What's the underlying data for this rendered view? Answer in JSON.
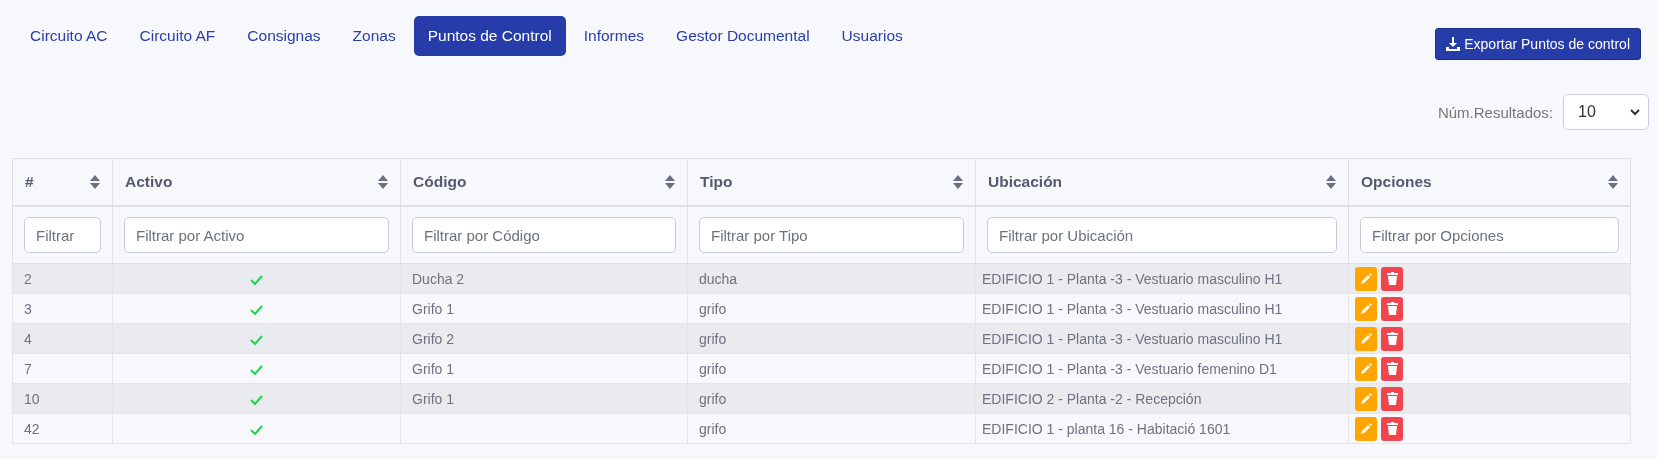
{
  "tabs": [
    {
      "label": "Circuito AC",
      "selected": false
    },
    {
      "label": "Circuito AF",
      "selected": false
    },
    {
      "label": "Consignas",
      "selected": false
    },
    {
      "label": "Zonas",
      "selected": false
    },
    {
      "label": "Puntos de Control",
      "selected": true
    },
    {
      "label": "Informes",
      "selected": false
    },
    {
      "label": "Gestor Documental",
      "selected": false
    },
    {
      "label": "Usuarios",
      "selected": false
    }
  ],
  "export_button": "Exportar Puntos de control",
  "results": {
    "label": "Núm.Resultados:",
    "value": "10"
  },
  "table": {
    "columns": [
      {
        "label": "#",
        "filter": {
          "placeholder": "Filtrar"
        }
      },
      {
        "label": "Activo",
        "filter": {
          "placeholder": "Filtrar por Activo"
        }
      },
      {
        "label": "Código",
        "filter": {
          "placeholder": "Filtrar por Código"
        }
      },
      {
        "label": "Tipo",
        "filter": {
          "placeholder": "Filtrar por Tipo"
        }
      },
      {
        "label": "Ubicación",
        "filter": {
          "placeholder": "Filtrar por Ubicación"
        }
      },
      {
        "label": "Opciones",
        "filter": {
          "placeholder": "Filtrar por Opciones"
        }
      }
    ],
    "rows": [
      {
        "id": "2",
        "active": true,
        "code": "Ducha 2",
        "type": "ducha",
        "location": "EDIFICIO 1 - Planta -3 - Vestuario masculino H1"
      },
      {
        "id": "3",
        "active": true,
        "code": "Grifo 1",
        "type": "grifo",
        "location": "EDIFICIO 1 - Planta -3 - Vestuario masculino H1"
      },
      {
        "id": "4",
        "active": true,
        "code": "Grifo 2",
        "type": "grifo",
        "location": "EDIFICIO 1 - Planta -3 - Vestuario masculino H1"
      },
      {
        "id": "7",
        "active": true,
        "code": "Grifo 1",
        "type": "grifo",
        "location": "EDIFICIO 1 - Planta -3 - Vestuario femenino D1"
      },
      {
        "id": "10",
        "active": true,
        "code": "Grifo 1",
        "type": "grifo",
        "location": "EDIFICIO 2 - Planta -2 - Recepción"
      },
      {
        "id": "42",
        "active": true,
        "type": "grifo",
        "location": "EDIFICIO 1 - planta 16 - Habitació 1601"
      }
    ]
  }
}
